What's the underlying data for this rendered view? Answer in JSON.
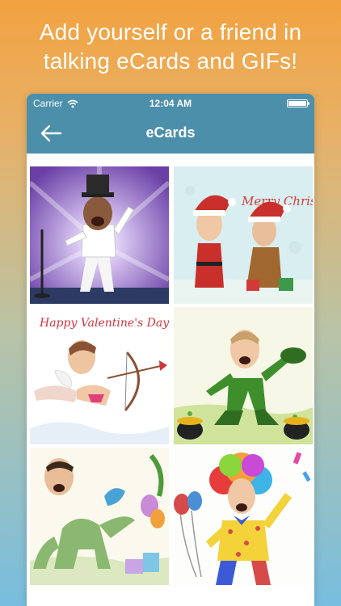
{
  "promo": {
    "line1": "Add yourself or a friend in",
    "line2": "talking eCards and GIFs!"
  },
  "status": {
    "carrier": "Carrier",
    "time": "12:04 AM",
    "battery_level": 1.0
  },
  "nav": {
    "title": "eCards",
    "back_icon": "back-arrow-icon"
  },
  "cards": [
    {
      "id": "singer",
      "theme": "singer"
    },
    {
      "id": "christmas",
      "theme": "christmas",
      "caption": "Merry Christmas"
    },
    {
      "id": "valentine",
      "theme": "valentine",
      "caption": "Happy Valentine's Day!"
    },
    {
      "id": "leprechaun",
      "theme": "leprechaun"
    },
    {
      "id": "dinosaur",
      "theme": "dinosaur-party"
    },
    {
      "id": "clown",
      "theme": "clown"
    }
  ],
  "colors": {
    "navbar": "#4c8fab",
    "background_top": "#f2a23f",
    "background_bottom": "#78bedf"
  }
}
